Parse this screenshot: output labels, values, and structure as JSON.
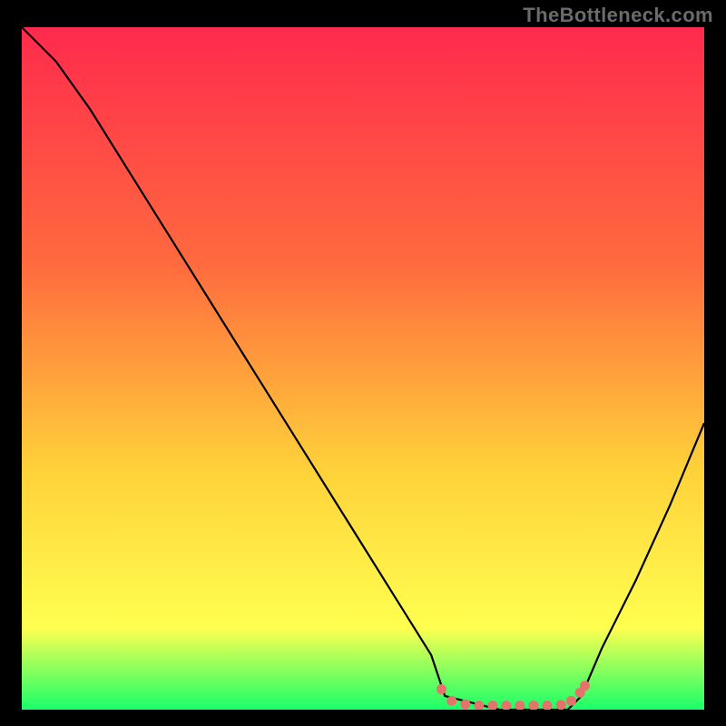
{
  "watermark": "TheBottleneck.com",
  "chart_data": {
    "type": "line",
    "title": "",
    "xlabel": "",
    "ylabel": "",
    "xlim": [
      0,
      100
    ],
    "ylim": [
      0,
      100
    ],
    "grid": false,
    "annotations": [],
    "background_gradient": {
      "top": "#ff2a4d",
      "mid1": "#ff6b3e",
      "mid2": "#ffd23a",
      "mid3": "#ffff50",
      "bottom": "#18ff6a"
    },
    "series": [
      {
        "name": "bottleneck-curve",
        "color": "#000000",
        "x": [
          0,
          5,
          10,
          15,
          20,
          25,
          30,
          35,
          40,
          45,
          50,
          55,
          60,
          62,
          70,
          80,
          82,
          85,
          90,
          95,
          100
        ],
        "y": [
          100,
          95,
          88,
          80,
          72,
          64,
          56,
          48,
          40,
          32,
          24,
          16,
          8,
          2,
          0,
          0,
          2,
          9,
          19,
          30,
          42
        ]
      }
    ],
    "markers": {
      "name": "highlight-band",
      "color": "#e4746b",
      "points": [
        {
          "x": 61.5,
          "y": 3.0
        },
        {
          "x": 63.0,
          "y": 1.3
        },
        {
          "x": 65.0,
          "y": 0.8
        },
        {
          "x": 67.0,
          "y": 0.6
        },
        {
          "x": 69.0,
          "y": 0.6
        },
        {
          "x": 71.0,
          "y": 0.6
        },
        {
          "x": 73.0,
          "y": 0.6
        },
        {
          "x": 75.0,
          "y": 0.6
        },
        {
          "x": 77.0,
          "y": 0.6
        },
        {
          "x": 79.0,
          "y": 0.7
        },
        {
          "x": 80.5,
          "y": 1.3
        },
        {
          "x": 81.8,
          "y": 2.5
        },
        {
          "x": 82.5,
          "y": 3.5
        }
      ]
    }
  }
}
